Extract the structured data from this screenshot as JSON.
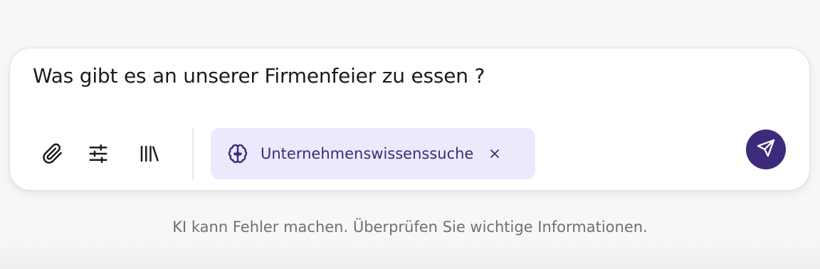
{
  "composer": {
    "prompt": "Was gibt es an unserer Firmenfeier zu essen ?",
    "chip": {
      "label": "Unternehmenswissenssuche",
      "icon": "brain-icon",
      "close_icon": "close-icon"
    },
    "toolbar": {
      "attach_icon": "paperclip-icon",
      "settings_icon": "sliders-icon",
      "library_icon": "library-icon"
    },
    "send_icon": "send-icon"
  },
  "footer": {
    "disclaimer": "KI kann Fehler machen. Überprüfen Sie wichtige Informationen."
  },
  "colors": {
    "accent": "#3d2a7a",
    "chip_background": "#ebe9fb",
    "chip_text": "#3f2a78"
  }
}
